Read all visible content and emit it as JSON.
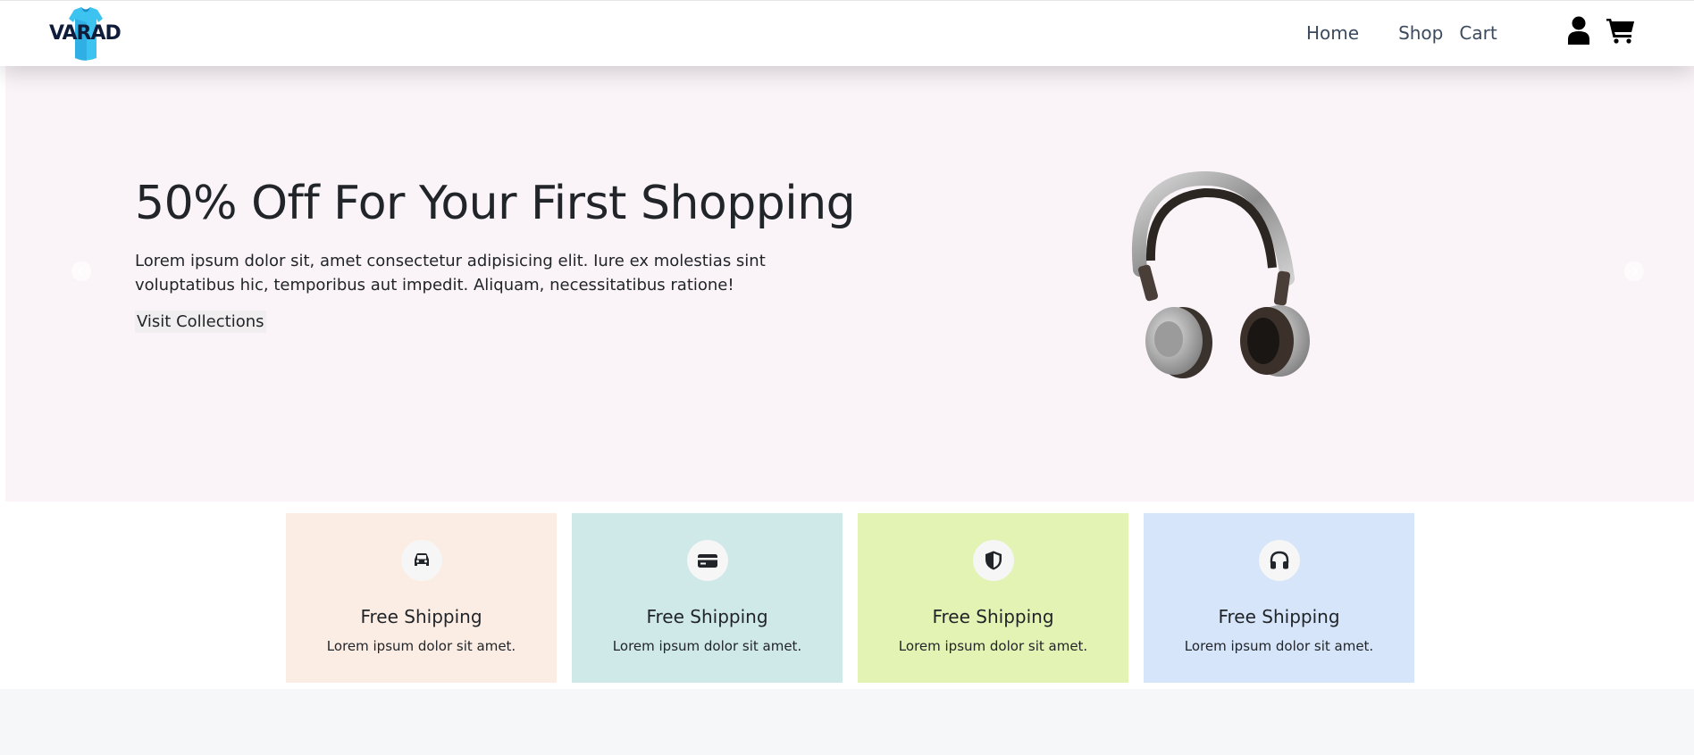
{
  "brand": {
    "name": "VARAD"
  },
  "nav": {
    "links": [
      "Home",
      "Shop",
      "Cart"
    ],
    "icons": [
      "user-icon",
      "cart-icon"
    ]
  },
  "hero": {
    "title": "50% Off For Your First Shopping",
    "description": "Lorem ipsum dolor sit, amet consectetur adipisicing elit. Iure ex molestias sint voluptatibus hic, temporibus aut impedit. Aliquam, necessitatibus ratione!",
    "button_label": "Visit Collections",
    "image": "headphones",
    "background": "#faf4f8"
  },
  "features": [
    {
      "icon": "car-icon",
      "title": "Free Shipping",
      "text": "Lorem ipsum dolor sit amet.",
      "bg": "#fcede4"
    },
    {
      "icon": "credit-card-icon",
      "title": "Free Shipping",
      "text": "Lorem ipsum dolor sit amet.",
      "bg": "#cfe9e8"
    },
    {
      "icon": "shield-icon",
      "title": "Free Shipping",
      "text": "Lorem ipsum dolor sit amet.",
      "bg": "#e3f3b4"
    },
    {
      "icon": "headphones-icon",
      "title": "Free Shipping",
      "text": "Lorem ipsum dolor sit amet.",
      "bg": "#d6e5fa"
    }
  ]
}
